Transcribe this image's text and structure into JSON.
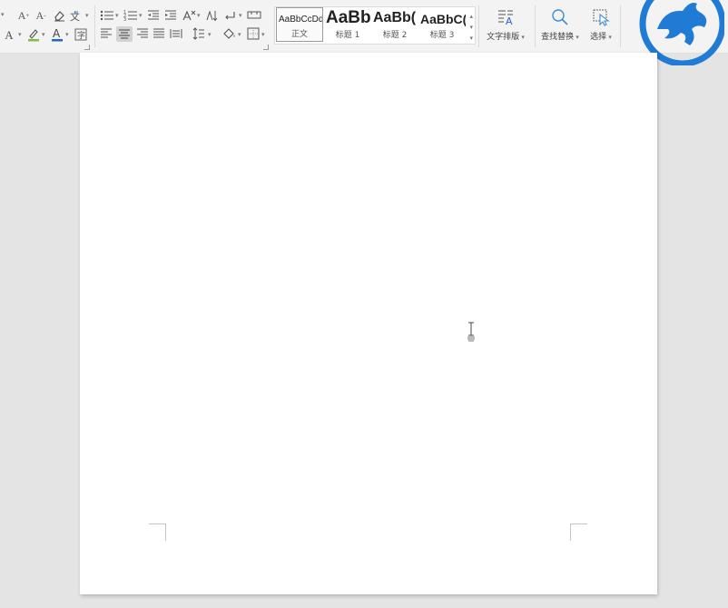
{
  "ribbon": {
    "styles": [
      {
        "preview": "AaBbCcDd",
        "label": "正文",
        "selected": true
      },
      {
        "preview": "AaBb",
        "label": "标题 1"
      },
      {
        "preview": "AaBb(",
        "label": "标题 2"
      },
      {
        "preview": "AaBbC(",
        "label": "标题 3"
      }
    ],
    "text_layout_label": "文字排版",
    "find_replace_label": "查找替换",
    "select_label": "选择"
  },
  "colors": {
    "logo_blue": "#1f7bd3",
    "highlight_green": "#7ac143",
    "font_color_blue": "#2266cc"
  }
}
